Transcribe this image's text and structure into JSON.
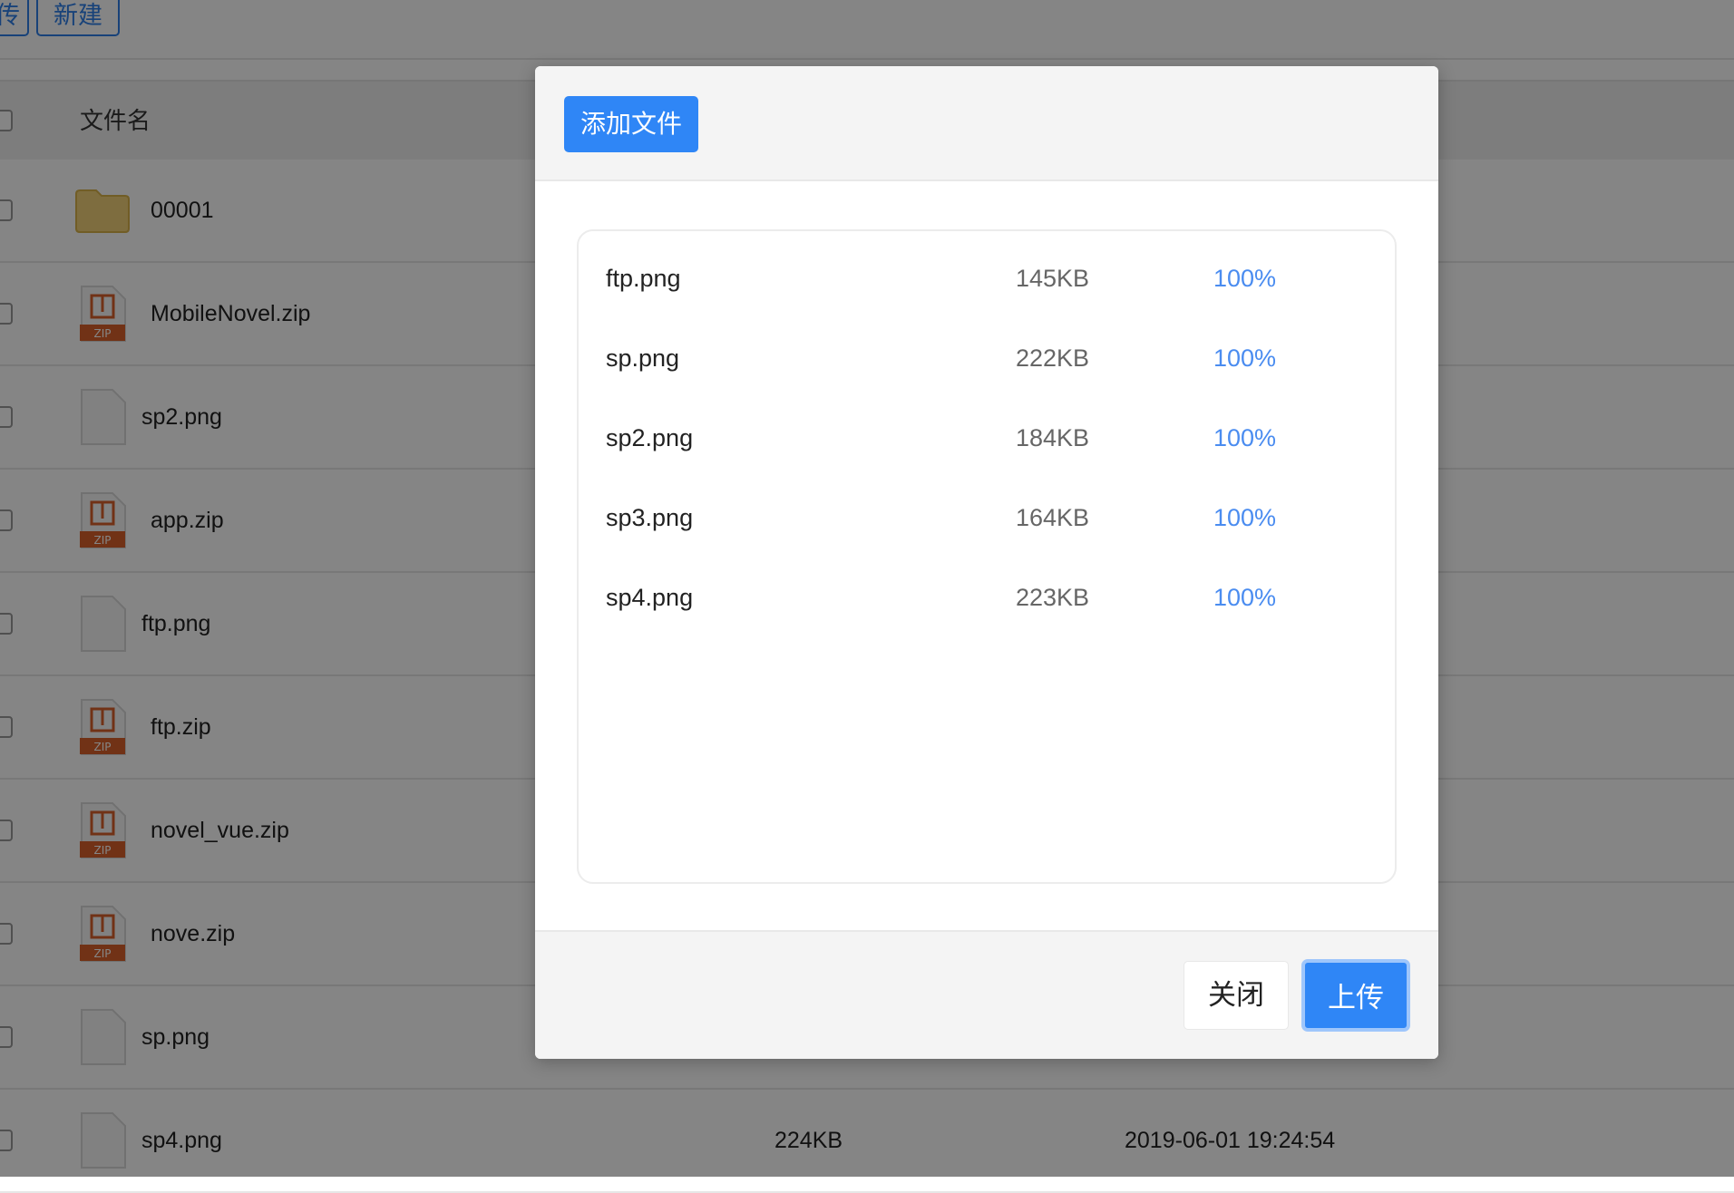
{
  "toolbar": {
    "upload_label": "传",
    "new_label": "新建"
  },
  "table": {
    "header": {
      "name_label": "文件名"
    },
    "rows": [
      {
        "name": "00001",
        "type": "folder",
        "size": "",
        "date": ""
      },
      {
        "name": "MobileNovel.zip",
        "type": "zip",
        "size": "",
        "date": ""
      },
      {
        "name": "sp2.png",
        "type": "file",
        "size": "",
        "date": ""
      },
      {
        "name": "app.zip",
        "type": "zip",
        "size": "",
        "date": ""
      },
      {
        "name": "ftp.png",
        "type": "file",
        "size": "",
        "date": ""
      },
      {
        "name": "ftp.zip",
        "type": "zip",
        "size": "",
        "date": ""
      },
      {
        "name": "novel_vue.zip",
        "type": "zip",
        "size": "",
        "date": ""
      },
      {
        "name": "nove.zip",
        "type": "zip",
        "size": "",
        "date": ""
      },
      {
        "name": "sp.png",
        "type": "file",
        "size": "",
        "date": ""
      },
      {
        "name": "sp4.png",
        "type": "file",
        "size": "224KB",
        "date": "2019-06-01 19:24:54"
      }
    ]
  },
  "modal": {
    "add_file_label": "添加文件",
    "files": [
      {
        "name": "ftp.png",
        "size": "145KB",
        "progress": "100%"
      },
      {
        "name": "sp.png",
        "size": "222KB",
        "progress": "100%"
      },
      {
        "name": "sp2.png",
        "size": "184KB",
        "progress": "100%"
      },
      {
        "name": "sp3.png",
        "size": "164KB",
        "progress": "100%"
      },
      {
        "name": "sp4.png",
        "size": "223KB",
        "progress": "100%"
      }
    ],
    "close_label": "关闭",
    "upload_label": "上传"
  },
  "icons": {
    "folder": "folder-icon",
    "zip": "zip-file-icon",
    "file": "file-icon"
  },
  "colors": {
    "accent": "#2f86f6",
    "progress": "#4a8cf0",
    "folder": "#f2d27a",
    "zip": "#d9602b"
  }
}
